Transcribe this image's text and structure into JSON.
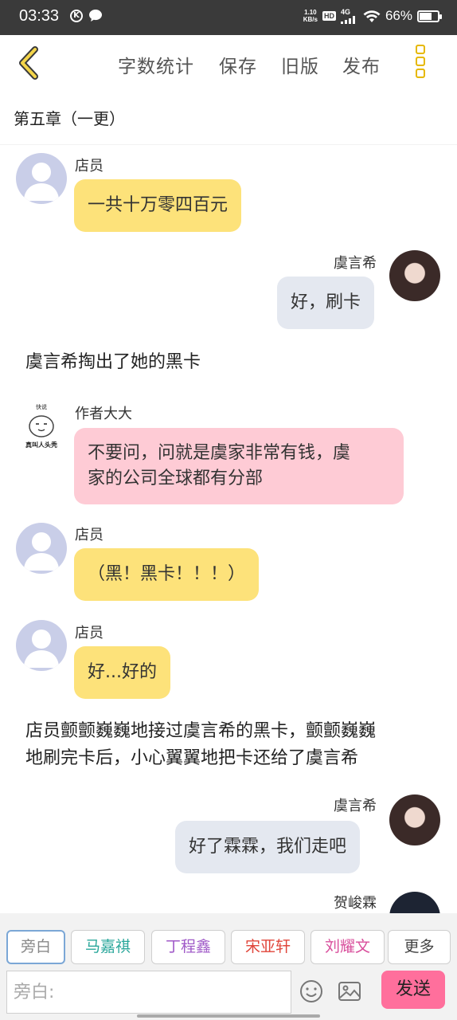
{
  "status_bar": {
    "time": "03:33",
    "k_badge": "K",
    "net_speed_value": "1.10",
    "net_speed_unit": "KB/s",
    "hd": "HD",
    "network": "4G",
    "battery_text": "66%",
    "battery_level": 0.66
  },
  "toolbar": {
    "word_count": "字数统计",
    "save": "保存",
    "old_version": "旧版",
    "publish": "发布"
  },
  "chapter_title": "第五章（一更）",
  "messages": [
    {
      "speaker": "店员",
      "text": "一共十万零四百元"
    },
    {
      "speaker": "虞言希",
      "text": "好，刷卡"
    },
    {
      "narration": "虞言希掏出了她的黑卡"
    },
    {
      "speaker": "作者大大",
      "avatar_caption_top": "快说",
      "avatar_caption_bottom": "真叫人头秃",
      "text_line1": "不要问，问就是虞家非常有钱，虞",
      "text_line2": "家的公司全球都有分部"
    },
    {
      "speaker": "店员",
      "text": "（黑！黑卡！！！）"
    },
    {
      "speaker": "店员",
      "text": "好...好的"
    },
    {
      "narration_line1": "店员颤颤巍巍地接过虞言希的黑卡，颤颤巍巍",
      "narration_line2": "地刷完卡后，小心翼翼地把卡还给了虞言希"
    },
    {
      "speaker": "虞言希",
      "text": "好了霖霖，我们走吧"
    },
    {
      "speaker": "贺峻霖"
    }
  ],
  "roles": [
    "旁白",
    "马嘉祺",
    "丁程鑫",
    "宋亚轩",
    "刘耀文",
    "更多"
  ],
  "colors": {
    "role_colors": [
      "#888888",
      "#2aa79b",
      "#a05ac8",
      "#e0453a",
      "#d94f9c",
      "#444444"
    ],
    "accent_yellow": "#e6b800",
    "send_button": "#ff6f9c"
  },
  "input": {
    "placeholder": "旁白:"
  },
  "send_label": "发送"
}
